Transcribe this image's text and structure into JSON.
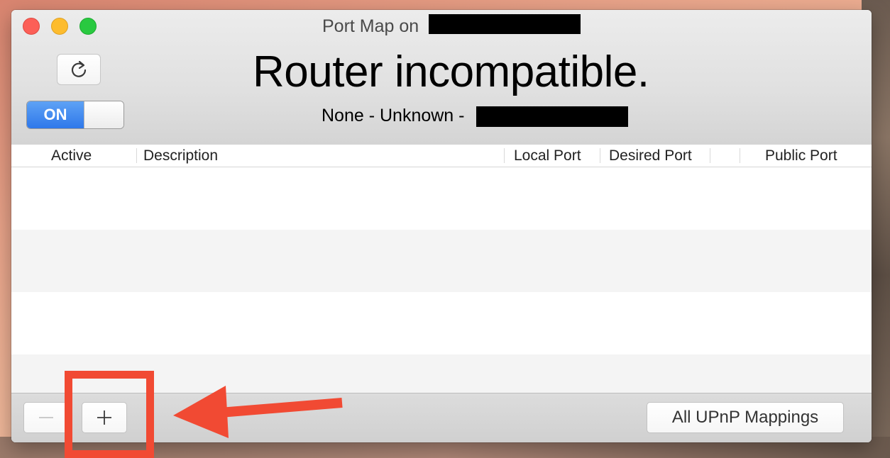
{
  "window": {
    "title": "Port Map on"
  },
  "status": {
    "headline": "Router incompatible.",
    "subline": "None - Unknown -"
  },
  "toggle": {
    "label": "ON"
  },
  "table": {
    "columns": [
      "Active",
      "Description",
      "Local Port",
      "Desired Port",
      "Public Port"
    ]
  },
  "footer": {
    "mappings_label": "All UPnP Mappings"
  },
  "colors": {
    "annotation": "#f14a33",
    "toggle_blue": "#2f78ea"
  },
  "icons": {
    "refresh": "refresh-icon",
    "remove": "minus-icon",
    "add": "plus-icon"
  }
}
